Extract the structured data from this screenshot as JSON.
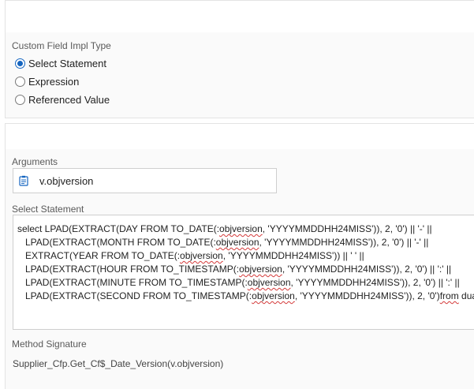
{
  "impl_type": {
    "label": "Custom Field Impl Type",
    "options": [
      {
        "label": "Select Statement",
        "selected": true
      },
      {
        "label": "Expression",
        "selected": false
      },
      {
        "label": "Referenced Value",
        "selected": false
      }
    ]
  },
  "arguments": {
    "label": "Arguments",
    "value": "v.objversion",
    "icon": "document-icon"
  },
  "select_statement": {
    "label": "Select Statement",
    "lines": [
      {
        "before": "select LPAD(EXTRACT(DAY FROM TO_DATE(:",
        "err": "objversion",
        "after": ", 'YYYYMMDDHH24MISS')), 2, '0') || '-' ||"
      },
      {
        "before": "   LPAD(EXTRACT(MONTH FROM TO_DATE(:",
        "err": "objversion",
        "after": ", 'YYYYMMDDHH24MISS')), 2, '0') || '-' ||"
      },
      {
        "before": "   EXTRACT(YEAR FROM TO_DATE(:",
        "err": "objversion",
        "after": ", 'YYYYMMDDHH24MISS')) || ' ' ||"
      },
      {
        "before": "   LPAD(EXTRACT(HOUR FROM TO_TIMESTAMP(:",
        "err": "objversion",
        "after": ", 'YYYYMMDDHH24MISS')), 2, '0') || ':' ||"
      },
      {
        "before": "   LPAD(EXTRACT(MINUTE FROM TO_TIMESTAMP(:",
        "err": "objversion",
        "after": ", 'YYYYMMDDHH24MISS')), 2, '0') || ':' ||"
      },
      {
        "before": "   LPAD(EXTRACT(SECOND FROM TO_TIMESTAMP(:",
        "err": "objversion",
        "after": ", 'YYYYMMDDHH24MISS')), 2, '0')",
        "err2": "from",
        "after2": " dual"
      }
    ]
  },
  "method_signature": {
    "label": "Method Signature",
    "value": "Supplier_Cfp.Get_Cf$_Date_Version(v.objversion)"
  },
  "colors": {
    "accent": "#1565c0",
    "spellcheck": "#d43a3a"
  }
}
